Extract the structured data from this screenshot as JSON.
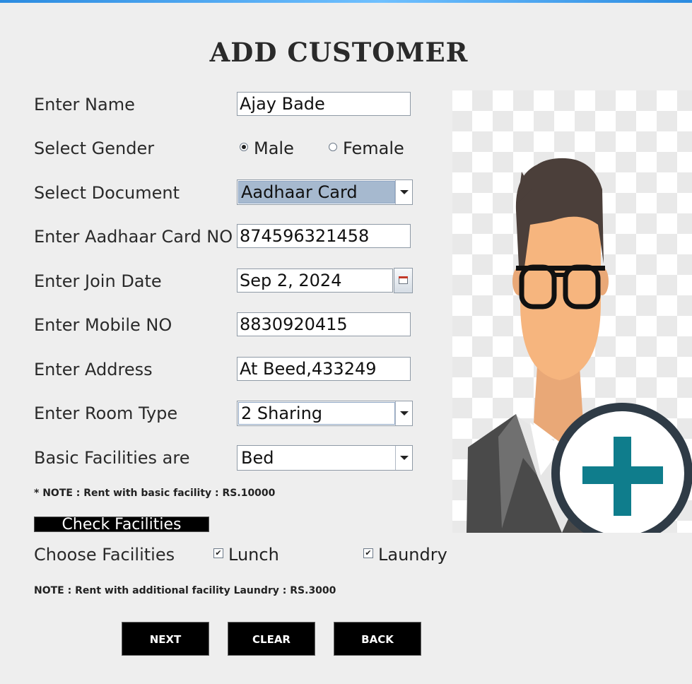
{
  "title": "ADD CUSTOMER",
  "fields": {
    "name_label": "Enter Name",
    "name_value": "Ajay Bade",
    "gender_label": "Select Gender",
    "gender_male": "Male",
    "gender_female": "Female",
    "gender_selected": "Male",
    "document_label": "Select Document",
    "document_value": "Aadhaar Card",
    "doc_no_label": "Enter Aadhaar Card NO",
    "doc_no_value": "874596321458",
    "join_date_label": "Enter Join Date",
    "join_date_value": "Sep 2, 2024",
    "mobile_label": "Enter Mobile NO",
    "mobile_value": "8830920415",
    "address_label": "Enter Address",
    "address_value": "At Beed,433249",
    "room_type_label": "Enter Room Type",
    "room_type_value": "2 Sharing",
    "basic_fac_label": "Basic Facilities are",
    "basic_fac_value": "Bed"
  },
  "notes": {
    "basic_rent": "* NOTE : Rent with basic facility : RS.10000",
    "additional_rent": "NOTE : Rent with additional facility Laundry : RS.3000"
  },
  "facilities": {
    "check_button": "Check Facilities",
    "choose_label": "Choose Facilities",
    "lunch_label": "Lunch",
    "lunch_checked": true,
    "laundry_label": "Laundry",
    "laundry_checked": true
  },
  "buttons": {
    "next": "NEXT",
    "clear": "CLEAR",
    "back": "BACK"
  },
  "colors": {
    "accent_bar": "#2b8be0",
    "button_bg": "#000000",
    "selected_combo": "#a6b9cf",
    "plus_teal": "#0f7d8c"
  }
}
